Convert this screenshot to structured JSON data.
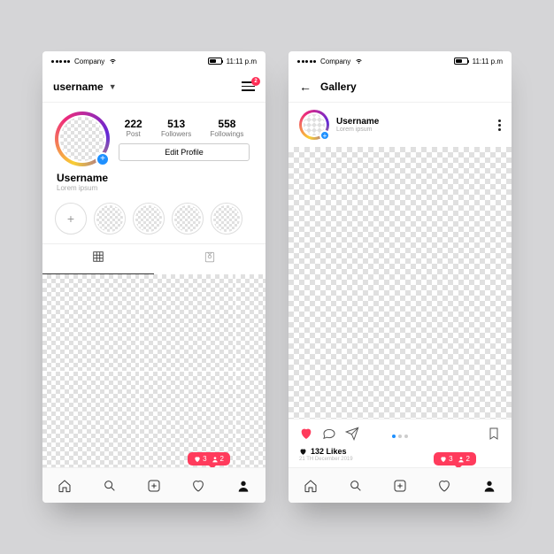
{
  "status": {
    "carrier": "Company",
    "time": "11:11 p.m"
  },
  "profile": {
    "header_username": "username",
    "notif_count": "2",
    "stats": {
      "posts": {
        "num": "222",
        "label": "Post"
      },
      "followers": {
        "num": "513",
        "label": "Followers"
      },
      "followings": {
        "num": "558",
        "label": "Followings"
      }
    },
    "edit_label": "Edit Profile",
    "display_name": "Username",
    "bio": "Lorem ipsum",
    "toast": {
      "likes": "3",
      "follows": "2"
    }
  },
  "gallery": {
    "title": "Gallery",
    "user": "Username",
    "sub": "Lorem ipsum",
    "likes_count": "132 Likes",
    "date": "21 TH December 2019",
    "toast": {
      "likes": "3",
      "follows": "2"
    }
  }
}
